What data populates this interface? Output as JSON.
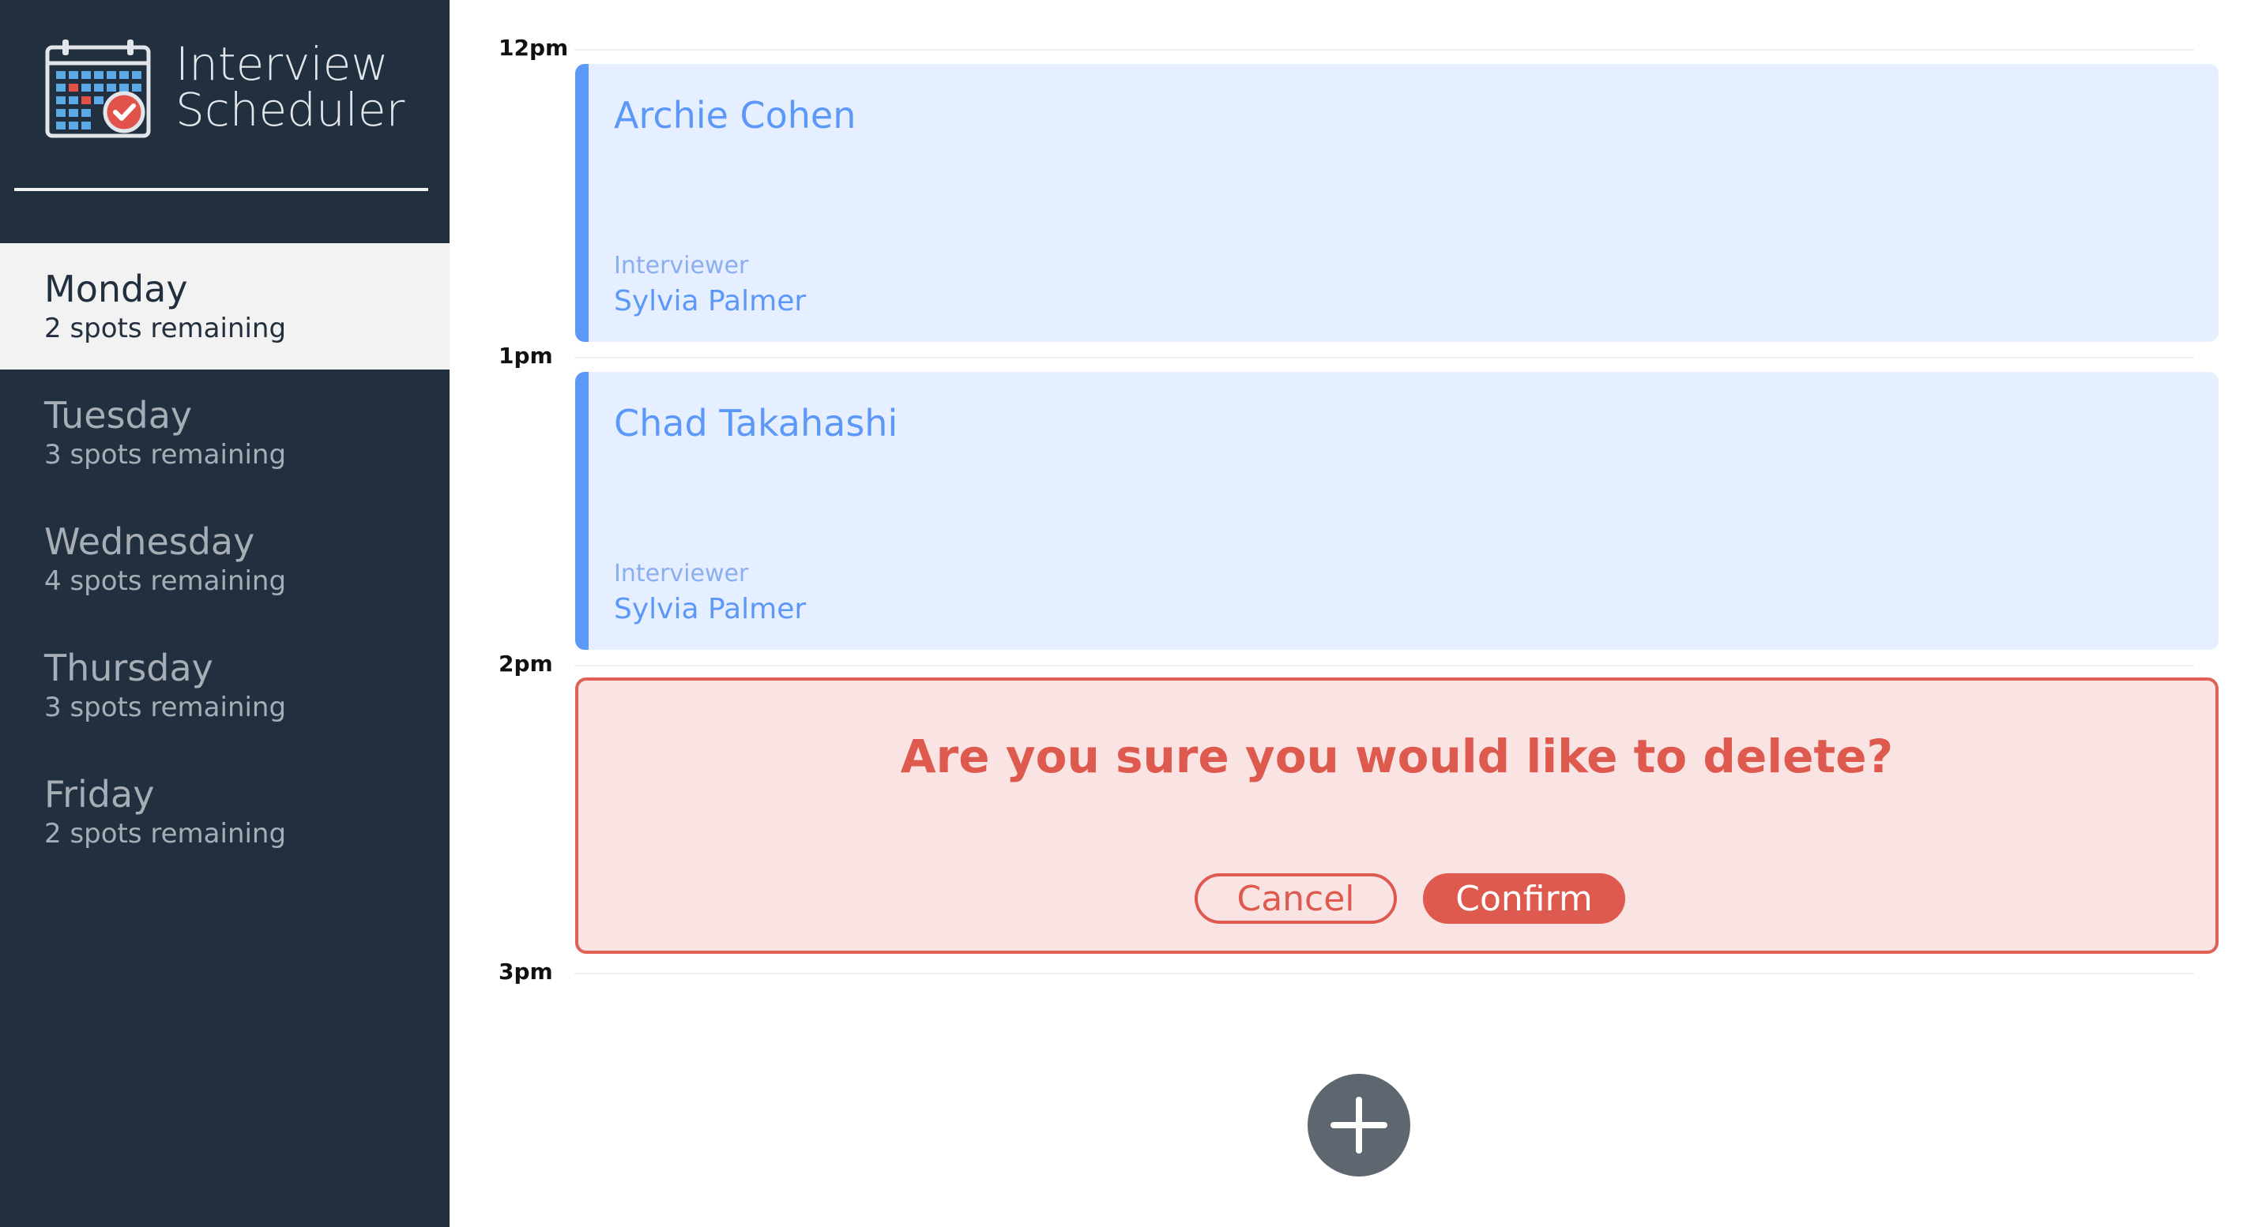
{
  "app": {
    "title_line1": "Interview",
    "title_line2": "Scheduler",
    "logo_icon": "calendar-check-icon"
  },
  "sidebar": {
    "days": [
      {
        "name": "Monday",
        "spots": "2 spots remaining",
        "selected": true
      },
      {
        "name": "Tuesday",
        "spots": "3 spots remaining",
        "selected": false
      },
      {
        "name": "Wednesday",
        "spots": "4 spots remaining",
        "selected": false
      },
      {
        "name": "Thursday",
        "spots": "3 spots remaining",
        "selected": false
      },
      {
        "name": "Friday",
        "spots": "2 spots remaining",
        "selected": false
      }
    ]
  },
  "schedule": {
    "times": [
      "12pm",
      "1pm",
      "2pm",
      "3pm"
    ],
    "appointments": [
      {
        "student": "Archie Cohen",
        "interviewer_label": "Interviewer",
        "interviewer": "Sylvia Palmer"
      },
      {
        "student": "Chad Takahashi",
        "interviewer_label": "Interviewer",
        "interviewer": "Sylvia Palmer"
      }
    ],
    "confirm": {
      "message": "Are you sure you would like to delete?",
      "cancel_label": "Cancel",
      "confirm_label": "Confirm"
    },
    "add_icon": "plus-icon"
  },
  "colors": {
    "sidebar_bg": "#222f3e",
    "appointment_accent": "#5b98f7",
    "appointment_bg": "#e6efff",
    "danger": "#df5a4e",
    "danger_bg": "#f9e3e3"
  }
}
